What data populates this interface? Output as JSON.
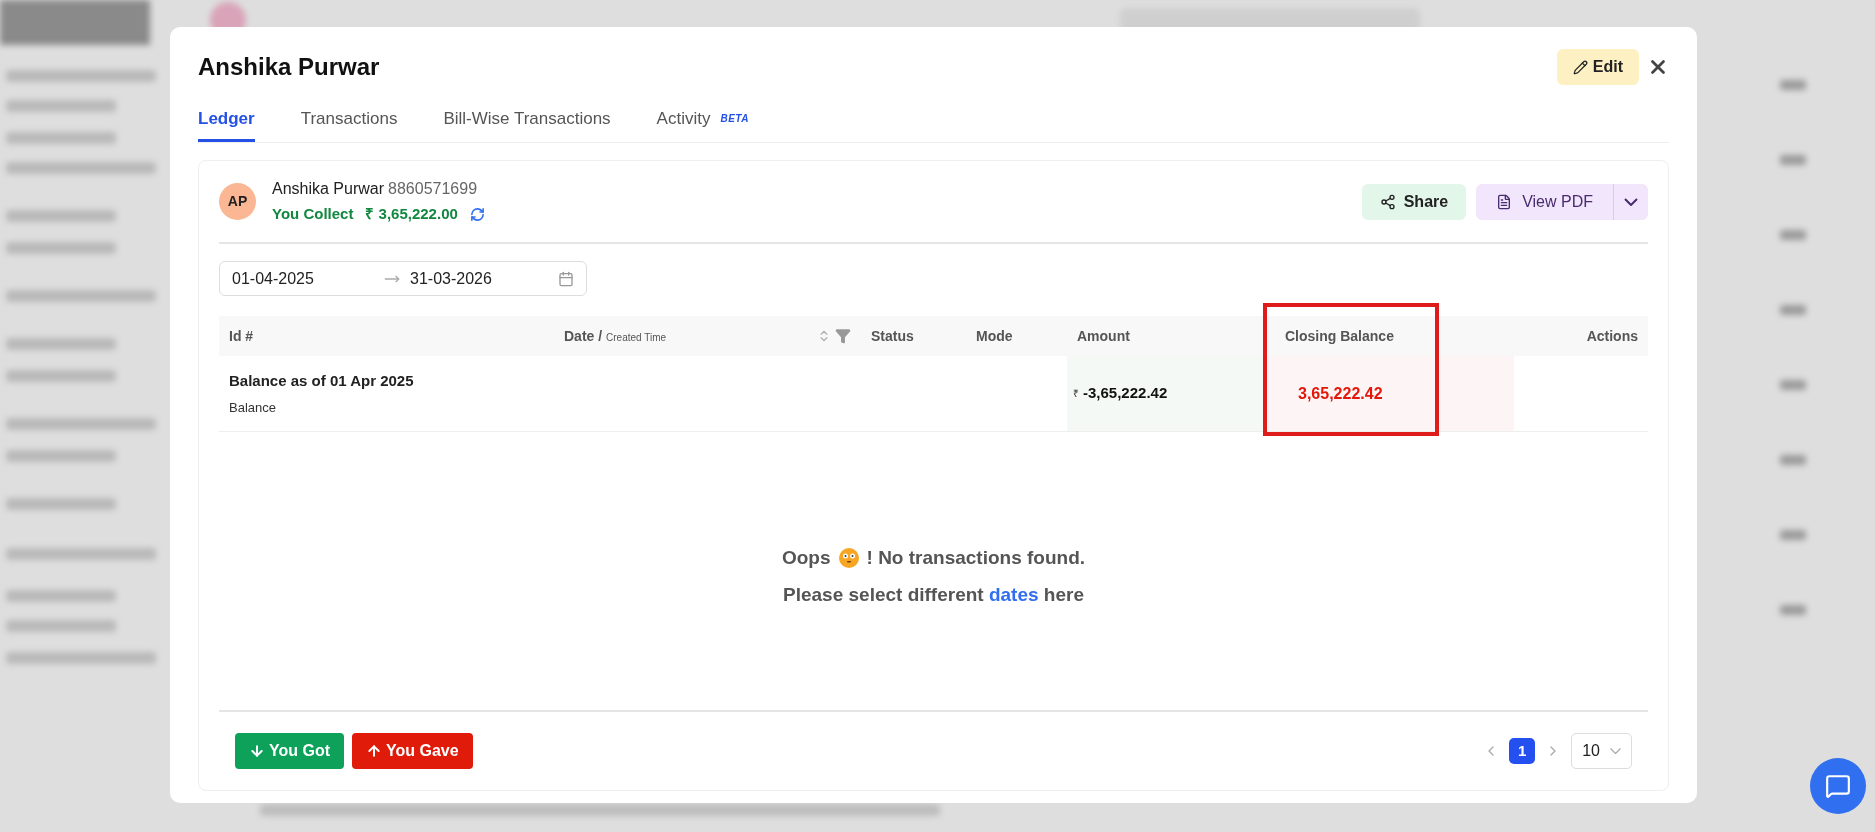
{
  "modal": {
    "title": "Anshika Purwar",
    "edit_button": "Edit"
  },
  "tabs": [
    {
      "label": "Ledger",
      "selected": true
    },
    {
      "label": "Transactions",
      "selected": false
    },
    {
      "label": "Bill-Wise Transactions",
      "selected": false
    },
    {
      "label": "Activity",
      "badge": "BETA",
      "selected": false
    }
  ],
  "party": {
    "initials": "AP",
    "name": "Anshika Purwar",
    "phone": "8860571699",
    "balance_label": "You Collect",
    "balance": "₹ 3,65,222.00"
  },
  "actions": {
    "share": "Share",
    "view_pdf": "View PDF"
  },
  "date_range": {
    "start": "01-04-2025",
    "end": "31-03-2026"
  },
  "table": {
    "columns": [
      {
        "label": "Id #"
      },
      {
        "label": "Date /",
        "sublabel": "Created Time"
      },
      {
        "label": "Status"
      },
      {
        "label": "Mode"
      },
      {
        "label": "Amount"
      },
      {
        "label": "Closing Balance",
        "highlighted": true
      },
      {
        "label": "Actions"
      }
    ],
    "rows": [
      {
        "id": "Balance as of 01 Apr 2025",
        "type": "Balance",
        "currency": "₹",
        "amount": "-3,65,222.42",
        "closing_balance": "3,65,222.42"
      }
    ]
  },
  "empty": {
    "oops": "Oops",
    "message": "! No transactions found.",
    "line2": "Please select different",
    "link": "dates",
    "line2_end": "here"
  },
  "footer": {
    "you_got": "You Got",
    "you_gave": "You Gave",
    "pages": [
      {
        "label": "1",
        "selected": true
      }
    ],
    "page_size": "10"
  }
}
